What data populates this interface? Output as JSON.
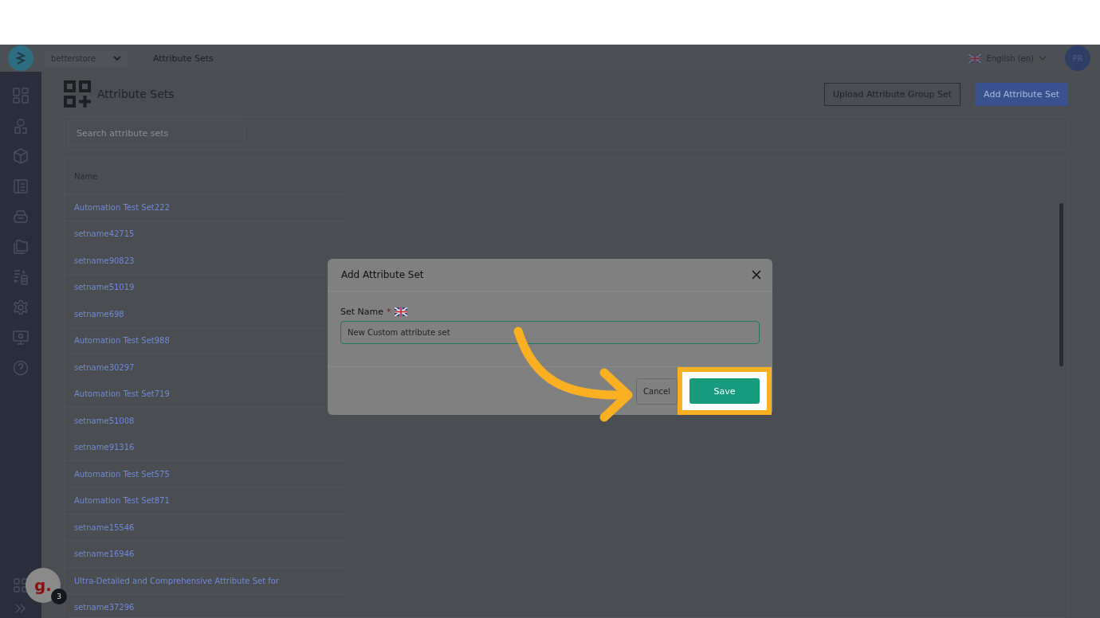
{
  "topbar": {
    "store": "betterstore",
    "breadcrumb": "Attribute Sets",
    "language": "English (en)",
    "avatar": "PR"
  },
  "page": {
    "title": "Attribute Sets",
    "upload_button": "Upload Attribute Group Set",
    "add_button": "Add Attribute Set",
    "search": {
      "placeholder": "Search attribute sets"
    },
    "table": {
      "columns": [
        "Name"
      ],
      "rows": [
        "Automation Test Set222",
        "setname42715",
        "setname90823",
        "setname51019",
        "setname698",
        "Automation Test Set988",
        "setname30297",
        "Automation Test Set719",
        "setname51008",
        "setname91316",
        "Automation Test Set575",
        "Automation Test Set871",
        "setname15546",
        "setname16946",
        "Ultra-Detailed and Comprehensive Attribute Set for",
        "setname37296"
      ]
    }
  },
  "dialog": {
    "title": "Add Attribute Set",
    "field_label": "Set Name",
    "required_mark": "*",
    "value": "New Custom attribute set",
    "cancel": "Cancel",
    "save": "Save"
  },
  "widget": {
    "letter": "g.",
    "badge": "3"
  }
}
